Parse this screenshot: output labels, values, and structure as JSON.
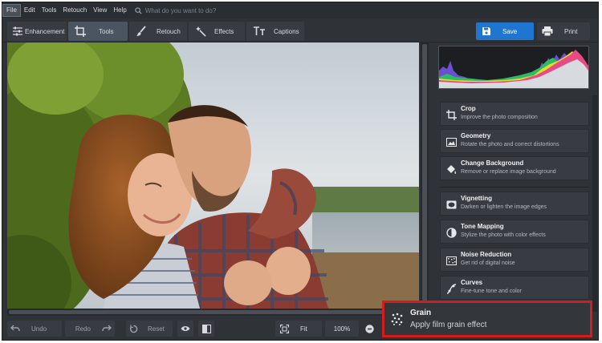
{
  "menu": {
    "items": [
      "File",
      "Edit",
      "Tools",
      "Retouch",
      "View",
      "Help"
    ],
    "search_placeholder": "What do you want to do?"
  },
  "toolbar": {
    "tabs": [
      {
        "label": "Enhancement",
        "icon": "sliders-icon"
      },
      {
        "label": "Tools",
        "icon": "crop-icon",
        "active": true
      },
      {
        "label": "Retouch",
        "icon": "brush-icon"
      },
      {
        "label": "Effects",
        "icon": "magic-wand-icon"
      },
      {
        "label": "Captions",
        "icon": "text-icon"
      }
    ],
    "save_label": "Save",
    "print_label": "Print"
  },
  "panel": {
    "tools": [
      {
        "title": "Crop",
        "desc": "Improve the photo composition",
        "icon": "crop-icon"
      },
      {
        "title": "Geometry",
        "desc": "Rotate the photo and correct distortions",
        "icon": "geometry-icon"
      },
      {
        "title": "Change Background",
        "desc": "Remove or replace image background",
        "icon": "paint-bucket-icon"
      },
      {
        "title": "Vignetting",
        "desc": "Darken or lighten the image edges",
        "icon": "vignette-icon"
      },
      {
        "title": "Tone Mapping",
        "desc": "Stylize the photo with color effects",
        "icon": "tone-icon"
      },
      {
        "title": "Noise Reduction",
        "desc": "Get rid of digital noise",
        "icon": "noise-icon"
      },
      {
        "title": "Curves",
        "desc": "Fine-tune tone and color",
        "icon": "curves-icon"
      }
    ],
    "highlight": {
      "title": "Grain",
      "desc": "Apply film grain effect",
      "icon": "grain-icon",
      "border_color": "#d41c1c"
    }
  },
  "bottom": {
    "undo_label": "Undo",
    "redo_label": "Redo",
    "reset_label": "Reset",
    "fit_label": "Fit",
    "zoom_label": "100%"
  },
  "colors": {
    "accent": "#1e76d0",
    "highlight": "#d41c1c"
  }
}
